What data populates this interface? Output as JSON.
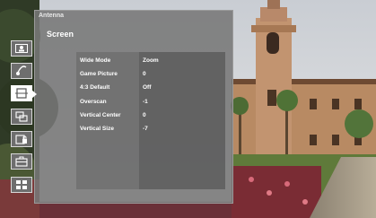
{
  "panel": {
    "source_label": "Antenna",
    "section_title": "Screen",
    "categories": [
      {
        "icon": "picture-icon"
      },
      {
        "icon": "audio-icon"
      },
      {
        "icon": "screen-icon",
        "active": true
      },
      {
        "icon": "setup-icon"
      },
      {
        "icon": "parental-lock-icon"
      },
      {
        "icon": "briefcase-icon"
      },
      {
        "icon": "applications-icon"
      }
    ]
  },
  "settings": {
    "rows": [
      {
        "label": "Wide Mode",
        "value": "Zoom"
      },
      {
        "label": "Game Picture",
        "value": "0"
      },
      {
        "label": "4:3 Default",
        "value": "Off"
      },
      {
        "label": "Overscan",
        "value": "-1"
      },
      {
        "label": "Vertical Center",
        "value": "0"
      },
      {
        "label": "Vertical Size",
        "value": "-7"
      }
    ]
  }
}
